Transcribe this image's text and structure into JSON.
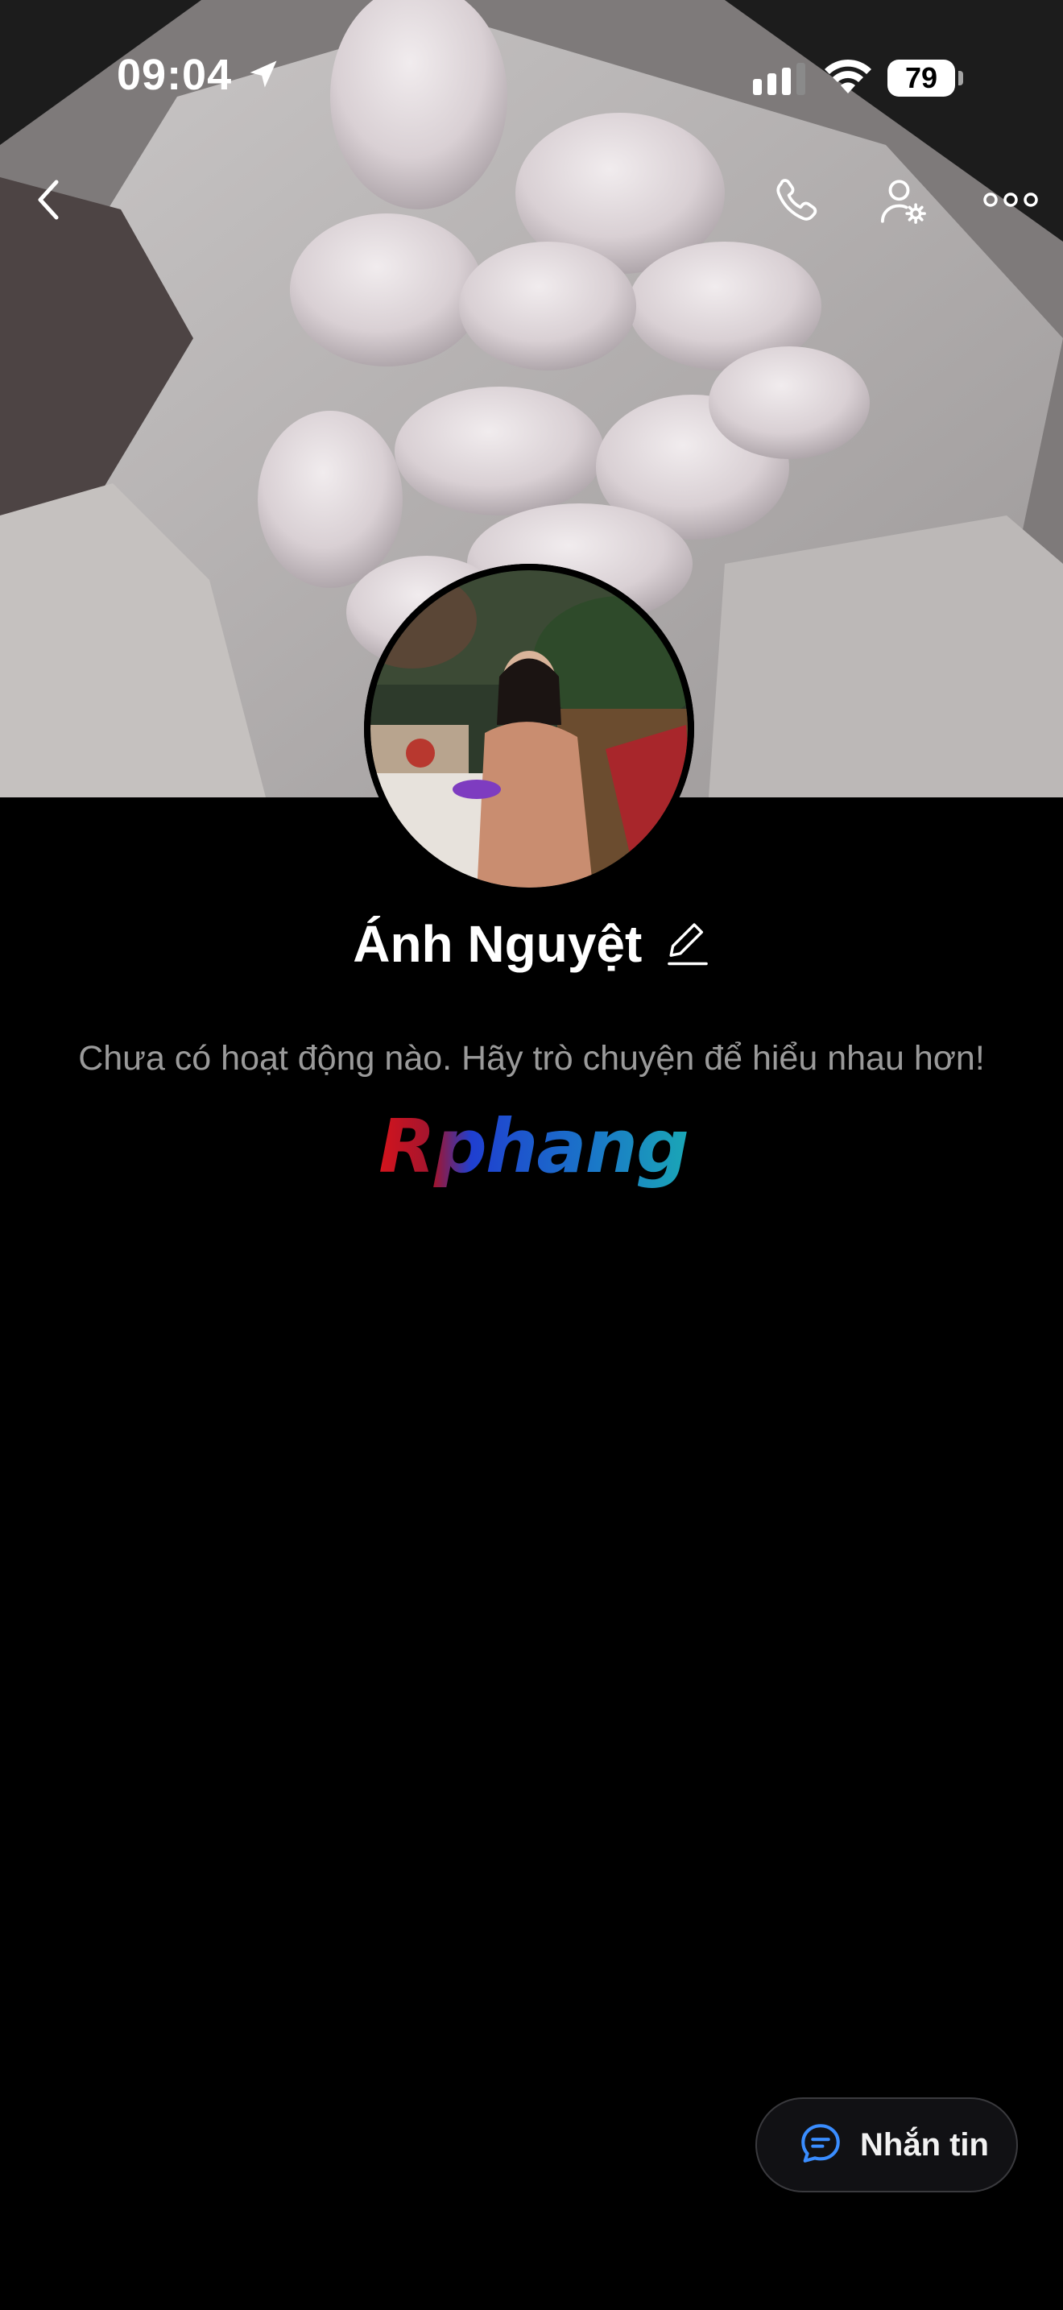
{
  "status_bar": {
    "time": "09:04",
    "battery": "79"
  },
  "profile": {
    "name": "Ánh Nguyệt",
    "activity_text": "Chưa có hoạt động nào. Hãy trò chuyện để hiểu nhau hơn!",
    "watermark": "Rphang"
  },
  "actions": {
    "message_label": "Nhắn tin"
  },
  "icons": {
    "back": "chevron-left-icon",
    "call": "phone-icon",
    "profile_settings": "user-gear-icon",
    "more": "more-horizontal-icon",
    "edit": "pencil-icon",
    "message": "chat-bubble-icon"
  },
  "colors": {
    "background": "#000000",
    "secondary_text": "#9a9a9a",
    "accent": "#3a8dff"
  }
}
